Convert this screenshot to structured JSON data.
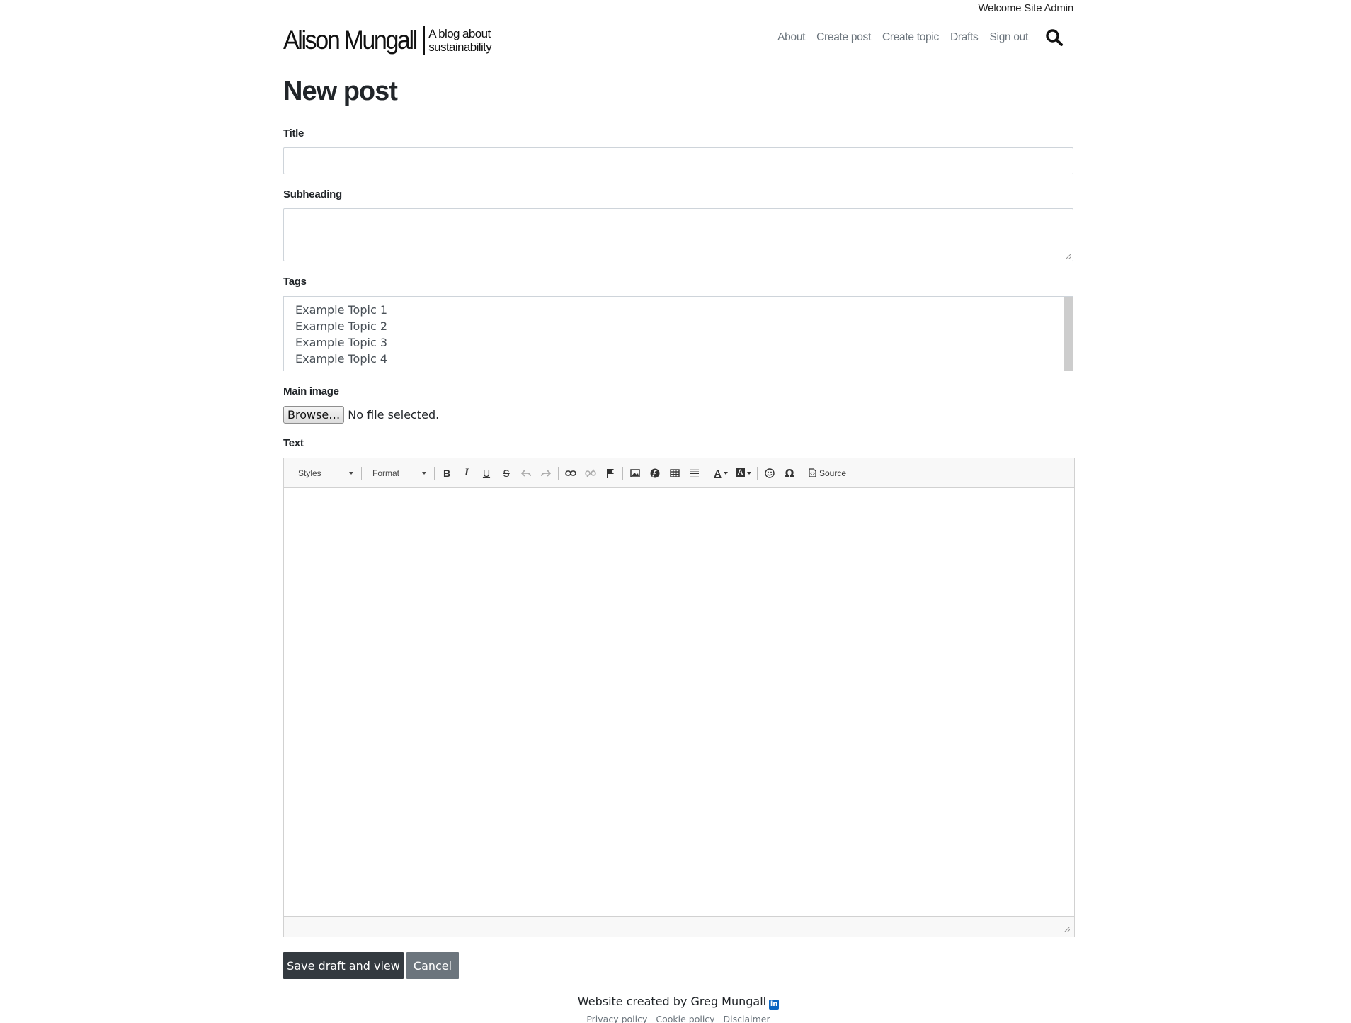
{
  "header": {
    "welcome": "Welcome Site Admin",
    "brand_name": "Alison Mungall",
    "brand_tagline_1": "A blog about",
    "brand_tagline_2": "sustainability",
    "nav": [
      "About",
      "Create post",
      "Create topic",
      "Drafts",
      "Sign out"
    ],
    "search_icon": "search-icon"
  },
  "page": {
    "title": "New post"
  },
  "form": {
    "title_label": "Title",
    "title_value": "",
    "subheading_label": "Subheading",
    "subheading_value": "",
    "tags_label": "Tags",
    "tags_options": [
      "Example Topic 1",
      "Example Topic 2",
      "Example Topic 3",
      "Example Topic 4"
    ],
    "main_image_label": "Main image",
    "browse_label": "Browse…",
    "file_status": "No file selected.",
    "text_label": "Text"
  },
  "editor": {
    "styles_label": "Styles",
    "format_label": "Format",
    "source_label": "Source",
    "toolbar_icons": [
      "bold-icon",
      "italic-icon",
      "underline-icon",
      "strikethrough-icon",
      "undo-icon",
      "redo-icon",
      "link-icon",
      "unlink-icon",
      "anchor-icon",
      "image-icon",
      "flash-icon",
      "table-icon",
      "horizontal-rule-icon",
      "text-color-icon",
      "background-color-icon",
      "smiley-icon",
      "special-char-icon",
      "source-icon"
    ]
  },
  "actions": {
    "save_label": "Save draft and view",
    "cancel_label": "Cancel"
  },
  "footer": {
    "credit": "Website created by Greg Mungall",
    "links": [
      "Privacy policy",
      "Cookie policy",
      "Disclaimer"
    ]
  },
  "colors": {
    "primary_dark": "#343a40",
    "secondary": "#6c757d",
    "linkedin": "#0a66c2"
  }
}
